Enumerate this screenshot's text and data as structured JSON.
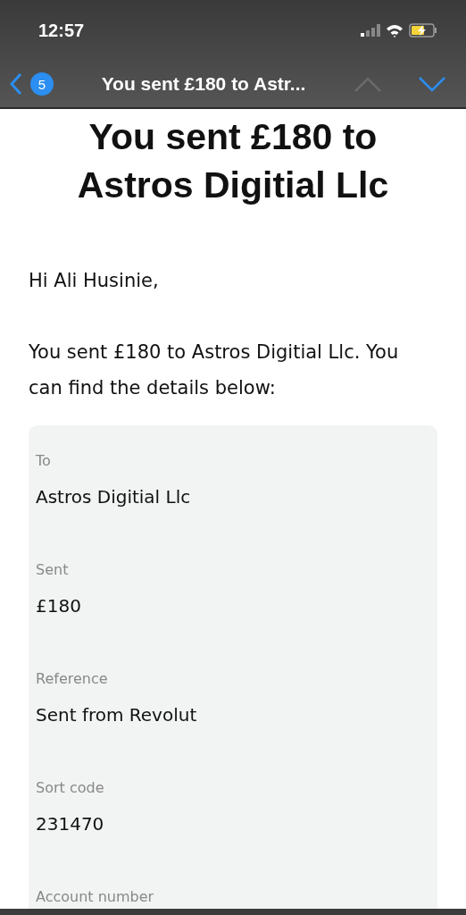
{
  "status_bar": {
    "time": "12:57"
  },
  "nav": {
    "unread_count": "5",
    "title": "You sent £180 to Astr...",
    "previous_enabled": false,
    "next_enabled": true
  },
  "email": {
    "heading": "You sent £180 to Astros Digitial Llc",
    "greeting": "Hi Ali Husinie,",
    "intro": "You sent £180 to Astros Digitial Llc. You can find the details below:",
    "details": [
      {
        "label": "To",
        "value": "Astros Digitial Llc"
      },
      {
        "label": "Sent",
        "value": "£180"
      },
      {
        "label": "Reference",
        "value": "Sent from Revolut"
      },
      {
        "label": "Sort code",
        "value": "231470"
      },
      {
        "label": "Account number"
      }
    ]
  }
}
